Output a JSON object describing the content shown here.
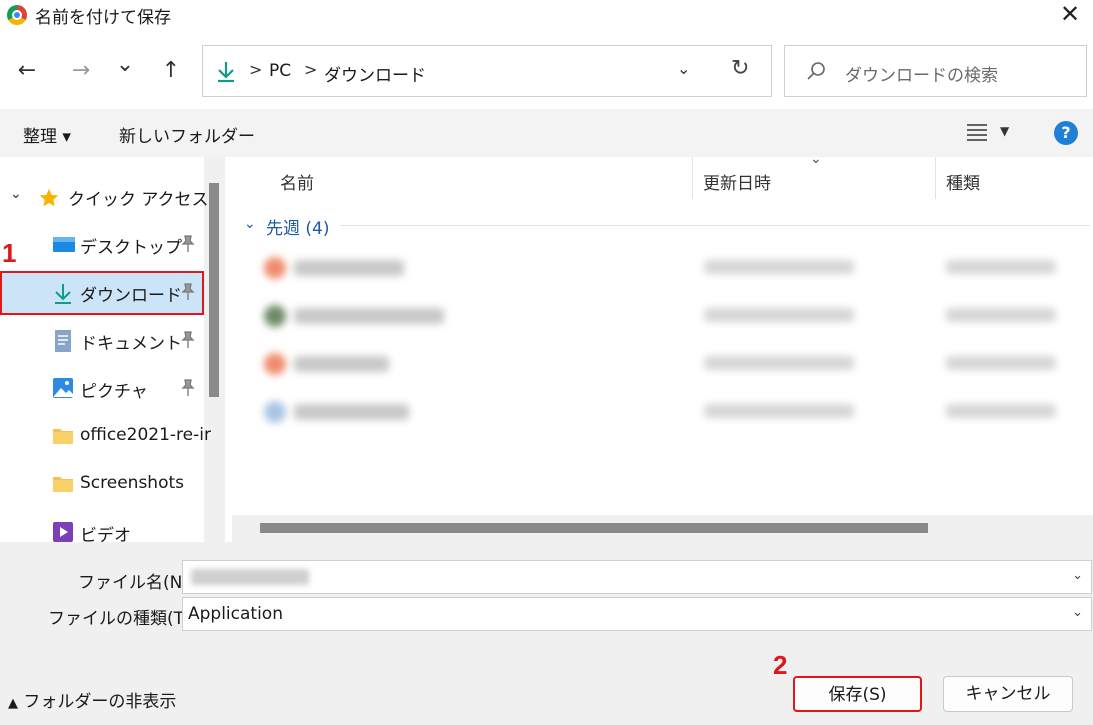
{
  "window": {
    "title": "名前を付けて保存",
    "close_glyph": "✕"
  },
  "nav": {
    "back": "←",
    "forward": "→",
    "recent": "⌄",
    "up": "↑",
    "breadcrumb": [
      "PC",
      "ダウンロード"
    ],
    "separator": ">",
    "dropdown": "⌄",
    "refresh": "↻",
    "search_placeholder": "ダウンロードの検索"
  },
  "toolbar": {
    "organize": "整理 ▾",
    "new_folder": "新しいフォルダー",
    "help": "?"
  },
  "sidebar": {
    "quick_access": "クイック アクセス",
    "items": [
      {
        "label": "デスクトップ",
        "icon": "desktop-icon",
        "pinned": true
      },
      {
        "label": "ダウンロード",
        "icon": "download-icon",
        "pinned": true,
        "selected": true
      },
      {
        "label": "ドキュメント",
        "icon": "document-icon",
        "pinned": true
      },
      {
        "label": "ピクチャ",
        "icon": "picture-icon",
        "pinned": true
      },
      {
        "label": "office2021-re-ir",
        "icon": "folder-icon",
        "pinned": false
      },
      {
        "label": "Screenshots",
        "icon": "folder-icon",
        "pinned": false
      },
      {
        "label": "ビデオ",
        "icon": "video-icon",
        "pinned": false
      }
    ]
  },
  "file_list": {
    "columns": [
      "名前",
      "更新日時",
      "種類"
    ],
    "group_label": "先週 (4)"
  },
  "form": {
    "filename_label": "ファイル名(N):",
    "filetype_label": "ファイルの種類(T):",
    "filetype_value": "Application"
  },
  "footer": {
    "hide_folders": "フォルダーの非表示",
    "save": "保存(S)",
    "cancel": "キャンセル"
  },
  "annotations": {
    "step1": "1",
    "step2": "2"
  },
  "colors": {
    "accent": "#1e7fd8",
    "highlight": "#e0161a",
    "selected_bg": "#cce4f7"
  }
}
